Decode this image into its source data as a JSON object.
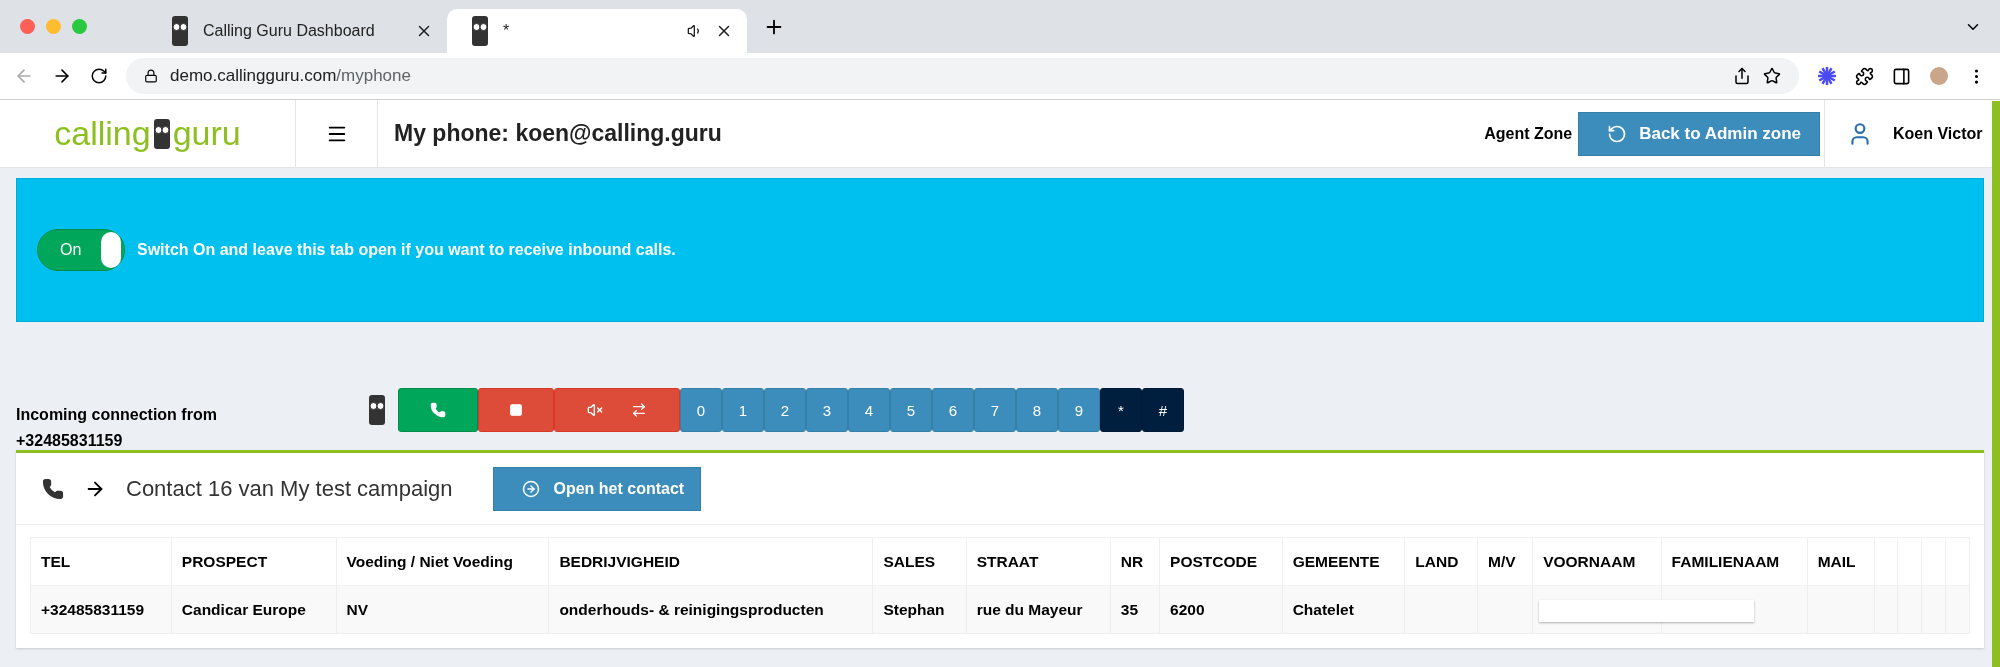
{
  "browser": {
    "tabs": [
      {
        "title": "Calling Guru Dashboard",
        "selected": false,
        "audio": false
      },
      {
        "title": "*",
        "selected": true,
        "audio": true
      }
    ],
    "url_host": "demo.callingguru.com",
    "url_path": "/myphone"
  },
  "header": {
    "logo_left": "calling",
    "logo_right": "guru",
    "title": "My phone: koen@calling.guru",
    "zone_label": "Agent Zone",
    "admin_button": "Back to Admin zone",
    "user": "Koen Victor"
  },
  "banner": {
    "switch": {
      "label": "On",
      "on": true
    },
    "text": "Switch On and leave this tab open if you want to receive inbound calls."
  },
  "phone": {
    "incoming_label": "Incoming connection from",
    "incoming_number": "+32485831159",
    "keys": [
      {
        "label": "0",
        "kind": "digit"
      },
      {
        "label": "1",
        "kind": "digit"
      },
      {
        "label": "2",
        "kind": "digit"
      },
      {
        "label": "3",
        "kind": "digit"
      },
      {
        "label": "4",
        "kind": "digit"
      },
      {
        "label": "5",
        "kind": "digit"
      },
      {
        "label": "6",
        "kind": "digit"
      },
      {
        "label": "7",
        "kind": "digit"
      },
      {
        "label": "8",
        "kind": "digit"
      },
      {
        "label": "9",
        "kind": "digit"
      },
      {
        "label": "*",
        "kind": "symbol"
      },
      {
        "label": "#",
        "kind": "symbol"
      }
    ]
  },
  "contact": {
    "title": "Contact 16 van My test campaign",
    "open_button": "Open het contact",
    "table": {
      "columns": [
        "TEL",
        "PROSPECT",
        "Voeding / Niet Voeding",
        "BEDRIJVIGHEID",
        "SALES",
        "STRAAT",
        "NR",
        "POSTCODE",
        "GEMEENTE",
        "LAND",
        "M/V",
        "VOORNAAM",
        "FAMILIENAAM",
        "MAIL"
      ],
      "rows": [
        [
          "+32485831159",
          "Candicar Europe",
          "NV",
          "onderhouds- & reinigingsproducten",
          "Stephan",
          "rue du Mayeur",
          "35",
          "6200",
          "Chatelet"
        ]
      ]
    }
  }
}
